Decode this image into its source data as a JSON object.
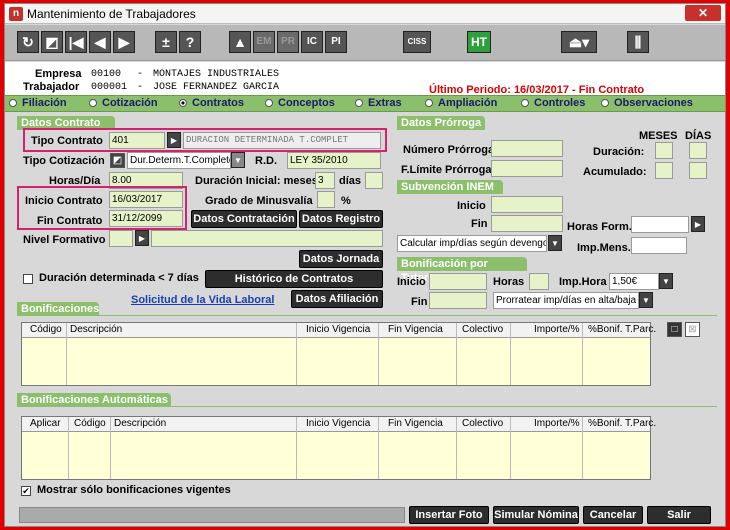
{
  "window": {
    "title": "Mantenimiento de Trabajadores",
    "close_label": "✕"
  },
  "toolbar": {
    "em": "EM",
    "pr": "PR",
    "ic": "IC",
    "pi": "PI",
    "ciss": "CISS",
    "ht": "HT"
  },
  "header": {
    "empresa_label": "Empresa",
    "empresa_code": "00100",
    "empresa_name": "MONTAJES INDUSTRIALES",
    "trabajador_label": "Trabajador",
    "trabajador_code": "000001",
    "trabajador_name": "JOSE FERNANDEZ GARCIA",
    "dash": "-",
    "periodo": "Último Periodo:  16/03/2017 - Fin Contrato"
  },
  "tabs": [
    {
      "label": "Filiación",
      "selected": false
    },
    {
      "label": "Cotización",
      "selected": false
    },
    {
      "label": "Contratos",
      "selected": true
    },
    {
      "label": "Conceptos",
      "selected": false
    },
    {
      "label": "Extras",
      "selected": false
    },
    {
      "label": "Ampliación",
      "selected": false
    },
    {
      "label": "Controles",
      "selected": false
    },
    {
      "label": "Observaciones",
      "selected": false
    }
  ],
  "datos_contrato": {
    "section": "Datos Contrato",
    "tipo_contrato_label": "Tipo Contrato",
    "tipo_contrato": "401",
    "tipo_contrato_desc": "DURACION DETERMINADA T.COMPLET",
    "tipo_cotizacion_label": "Tipo Cotización",
    "tipo_cotizacion": "Dur.Determ.T.Completo",
    "rd_label": "R.D.",
    "rd": "LEY 35/2010",
    "horas_dia_label": "Horas/Día",
    "horas_dia": "8.00",
    "duracion_inicial_label": "Duración Inicial: meses",
    "duracion_meses": "3",
    "dias_label": "días",
    "inicio_contrato_label": "Inicio Contrato",
    "inicio_contrato": "16/03/2017",
    "grado_minusvalia_label": "Grado de Minusvalía",
    "percent": "%",
    "fin_contrato_label": "Fin Contrato",
    "fin_contrato": "31/12/2099",
    "datos_contratacion": "Datos Contratación",
    "datos_registro": "Datos Registro",
    "nivel_formativo_label": "Nivel Formativo",
    "datos_jornada": "Datos Jornada",
    "duracion_det_label": "Duración determinada < 7 días",
    "historico": "Histórico de Contratos",
    "solicitud": "Solicitud de la Vida Laboral",
    "datos_afiliacion": "Datos Afiliación"
  },
  "prorroga": {
    "section": "Datos Prórroga",
    "meses": "MESES",
    "dias": "DÍAS",
    "numero_label": "Número Prórroga",
    "duracion_label": "Duración:",
    "limite_label": "F.Límite Prórroga",
    "acumulado_label": "Acumulado:"
  },
  "subvencion": {
    "section": "Subvención INEM",
    "inicio_label": "Inicio",
    "fin_label": "Fin",
    "horas_form_label": "Horas Form.",
    "calc_select": "Calcular imp/días según devengo",
    "imp_mens_label": "Imp.Mens."
  },
  "tutoria": {
    "section": "Bonificación por Tutoría",
    "inicio_label": "Inicio",
    "horas_label": "Horas",
    "imp_hora_label": "Imp.Hora",
    "imp_hora": "1,50€",
    "fin_label": "Fin",
    "prorratear": "Prorratear imp/días en alta/baja"
  },
  "bonificaciones": {
    "section": "Bonificaciones",
    "columns": [
      "Código",
      "Descripción",
      "Inicio Vigencia",
      "Fin Vigencia",
      "Colectivo",
      "Importe/%",
      "%Bonif. T.Parc."
    ]
  },
  "bonif_auto": {
    "section": "Bonificaciones Automáticas",
    "columns": [
      "Aplicar",
      "Código",
      "Descripción",
      "Inicio Vigencia",
      "Fin Vigencia",
      "Colectivo",
      "Importe/%",
      "%Bonif. T.Parc."
    ],
    "mostrar_label": "Mostrar sólo bonificaciones vigentes",
    "mostrar_checked": true
  },
  "footer": {
    "insertar_foto": "Insertar Foto",
    "simular_nomina": "Simular Nómina",
    "cancelar": "Cancelar",
    "salir": "Salir"
  }
}
